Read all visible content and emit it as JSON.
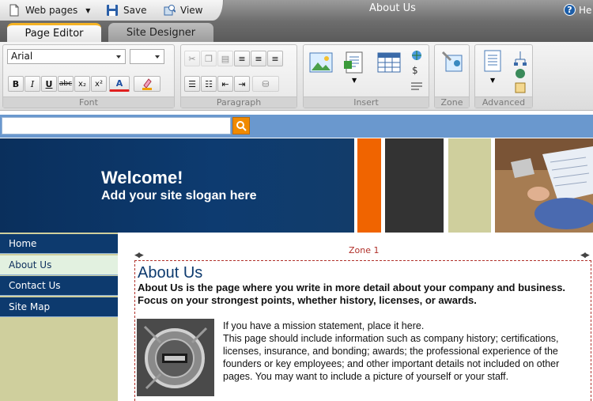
{
  "titlebar": {
    "web_pages_label": "Web pages",
    "save_label": "Save",
    "view_label": "View",
    "title": "About Us",
    "help_label": "He"
  },
  "tabs": [
    {
      "label": "Page Editor",
      "active": true
    },
    {
      "label": "Site Designer",
      "active": false
    }
  ],
  "ribbon": {
    "font_group_label": "Font",
    "font_name": "Arial",
    "font_size": "",
    "paragraph_group_label": "Paragraph",
    "insert_group_label": "Insert",
    "zone_group_label": "Zone",
    "advanced_group_label": "Advanced",
    "bold": "B",
    "italic": "I",
    "underline": "U",
    "strike": "abc",
    "subscript": "x₂",
    "superscript": "x²",
    "font_color": "A"
  },
  "site": {
    "search_placeholder": "",
    "welcome": "Welcome!",
    "slogan": "Add your site slogan here",
    "nav": [
      {
        "label": "Home",
        "active": false
      },
      {
        "label": "About Us",
        "active": true
      },
      {
        "label": "Contact Us",
        "active": false
      },
      {
        "label": "Site Map",
        "active": false
      }
    ],
    "zone_label": "Zone 1",
    "page_heading": "About Us",
    "intro": "About Us is the page where you write in more detail about your company and business. Focus on your strongest points, whether history, licenses, or awards.",
    "body_line1": "If you have a mission statement, place it here.",
    "body_line2": "This page should include information such as company history; certifications, licenses, insurance, and bonding; awards; the professional experience of the founders or key employees; and other important details not included on other pages. You may want to include a picture of yourself or your staff."
  },
  "colors": {
    "accent_orange": "#f08a00",
    "nav_blue": "#0d3a6e",
    "zone_red": "#b0302a",
    "sidebar_khaki": "#cfcf9d"
  }
}
